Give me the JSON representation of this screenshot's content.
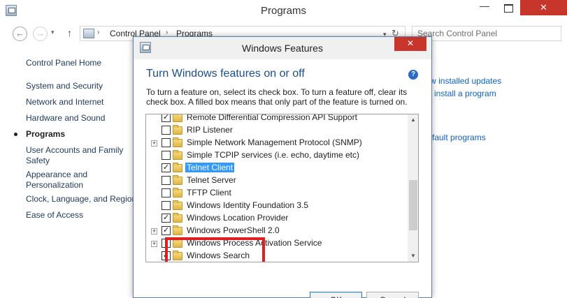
{
  "window": {
    "title": "Programs",
    "close_glyph": "✕",
    "minimize_glyph": "—"
  },
  "addressbar": {
    "back_glyph": "←",
    "forward_glyph": "→",
    "recent_glyph": "▾",
    "up_glyph": "↑",
    "crumbs": [
      "Control Panel",
      "Programs"
    ],
    "crumb_separator": "›",
    "dropdown_glyph": "▾",
    "refresh_glyph": "↻",
    "search_placeholder": "Search Control Panel"
  },
  "sidebar": {
    "items": [
      {
        "label": "Control Panel Home",
        "current": false
      },
      {
        "label": "System and Security",
        "current": false
      },
      {
        "label": "Network and Internet",
        "current": false
      },
      {
        "label": "Hardware and Sound",
        "current": false
      },
      {
        "label": "Programs",
        "current": true
      },
      {
        "label": "User Accounts and Family Safety",
        "current": false
      },
      {
        "label": "Appearance and Personalization",
        "current": false
      },
      {
        "label": "Clock, Language, and Region",
        "current": false
      },
      {
        "label": "Ease of Access",
        "current": false
      }
    ]
  },
  "main": {
    "partial_links": [
      "View installed updates",
      "install a program",
      "fault programs"
    ]
  },
  "dialog": {
    "title": "Windows Features",
    "close_glyph": "✕",
    "heading": "Turn Windows features on or off",
    "help_glyph": "?",
    "description": "To turn a feature on, select its check box. To turn a feature off, clear its check box. A filled box means that only part of the feature is turned on.",
    "check_glyph": "✓",
    "expand_glyph": "+",
    "features": [
      {
        "label": "Remote Differential Compression API Support",
        "checked": true,
        "expandable": false,
        "selected": false
      },
      {
        "label": "RIP Listener",
        "checked": false,
        "expandable": false,
        "selected": false
      },
      {
        "label": "Simple Network Management Protocol (SNMP)",
        "checked": false,
        "expandable": true,
        "selected": false
      },
      {
        "label": "Simple TCPIP services (i.e. echo, daytime etc)",
        "checked": false,
        "expandable": false,
        "selected": false
      },
      {
        "label": "Telnet Client",
        "checked": true,
        "expandable": false,
        "selected": true
      },
      {
        "label": "Telnet Server",
        "checked": false,
        "expandable": false,
        "selected": false
      },
      {
        "label": "TFTP Client",
        "checked": false,
        "expandable": false,
        "selected": false
      },
      {
        "label": "Windows Identity Foundation 3.5",
        "checked": false,
        "expandable": false,
        "selected": false
      },
      {
        "label": "Windows Location Provider",
        "checked": true,
        "expandable": false,
        "selected": false
      },
      {
        "label": "Windows PowerShell 2.0",
        "checked": true,
        "expandable": true,
        "selected": false
      },
      {
        "label": "Windows Process Activation Service",
        "checked": false,
        "expandable": true,
        "selected": false
      },
      {
        "label": "Windows Search",
        "checked": true,
        "expandable": false,
        "selected": false
      }
    ],
    "scroll_up_glyph": "▲",
    "scroll_down_glyph": "▼",
    "ok_label": "OK",
    "cancel_label": "Cancel"
  },
  "colors": {
    "accent": "#1b4f8a",
    "selection": "#3399ff",
    "highlight_box": "#e02020",
    "close_button": "#c7352b",
    "link": "#0e62c2"
  }
}
